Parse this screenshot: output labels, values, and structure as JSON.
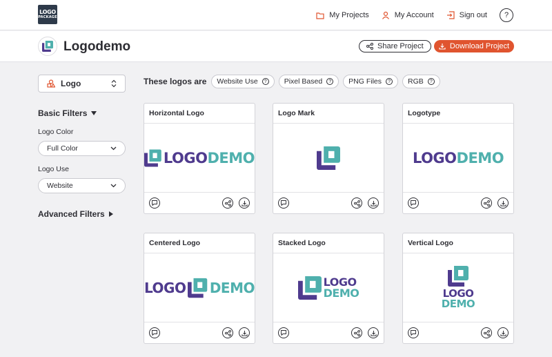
{
  "brand": {
    "line1": "LOGO",
    "line2": "PACKAGE"
  },
  "nav": {
    "my_projects": "My Projects",
    "my_account": "My Account",
    "sign_out": "Sign out",
    "help": "?"
  },
  "project": {
    "title": "Logodemo",
    "share_label": "Share Project",
    "download_label": "Download Project"
  },
  "sidebar": {
    "asset_type": "Logo",
    "basic_filters_title": "Basic Filters",
    "logo_color_label": "Logo Color",
    "logo_color_value": "Full Color",
    "logo_use_label": "Logo Use",
    "logo_use_value": "Website",
    "advanced_filters_title": "Advanced Filters"
  },
  "filters": {
    "intro": "These logos are",
    "pills": [
      "Website Use",
      "Pixel Based",
      "PNG Files",
      "RGB"
    ]
  },
  "wordmark": {
    "part1": "LOGO",
    "part2": "DEMO"
  },
  "cards": [
    {
      "title": "Horizontal Logo"
    },
    {
      "title": "Logo Mark"
    },
    {
      "title": "Logotype"
    },
    {
      "title": "Centered Logo"
    },
    {
      "title": "Stacked Logo"
    },
    {
      "title": "Vertical Logo"
    }
  ],
  "colors": {
    "accent": "#e0542f",
    "brand_purple": "#4f3b8e",
    "brand_teal": "#4fb0ad",
    "navy": "#2e3a4a"
  },
  "icons": {
    "folder": "folder-icon",
    "user": "user-icon",
    "signout": "sign-out-icon",
    "share": "share-icon",
    "download": "download-icon",
    "comment": "comment-icon",
    "chevron": "chevron-down-icon",
    "sort": "up-down-chevron-icon"
  }
}
